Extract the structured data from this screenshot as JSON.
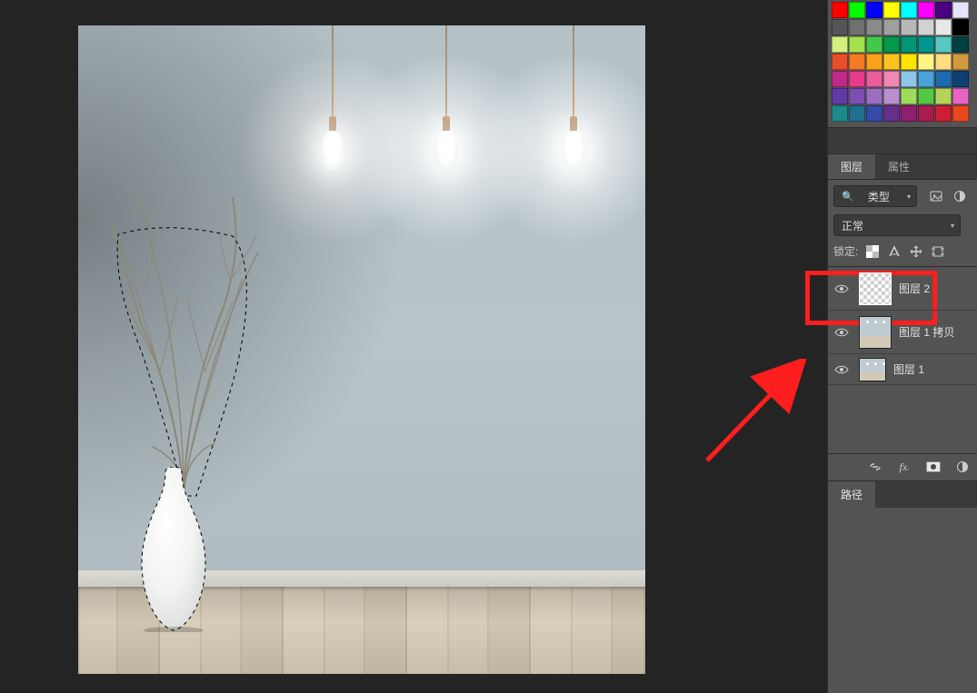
{
  "swatches": [
    "#ff0000",
    "#00ff00",
    "#0000ff",
    "#ffff00",
    "#00ffff",
    "#ff00ff",
    "#4b0082",
    "#e6e6fa",
    "#555555",
    "#707070",
    "#8a8a8a",
    "#a0a0a0",
    "#b8b8b8",
    "#d2d2d2",
    "#e8e8e8",
    "#000000",
    "#d4f07e",
    "#a3e24b",
    "#43c84a",
    "#009a4a",
    "#009778",
    "#00958d",
    "#57c9c3",
    "#004040",
    "#e94f2c",
    "#f47a25",
    "#f9a11b",
    "#fbc31e",
    "#fee400",
    "#fff685",
    "#ffdd80",
    "#d19a3f",
    "#c02a86",
    "#e83a8a",
    "#eb5d9c",
    "#f187b3",
    "#8cc7e8",
    "#48a3db",
    "#1c6bb0",
    "#103f73",
    "#5f3aa6",
    "#7b4fb1",
    "#9a6fbf",
    "#b98fce",
    "#9fdc5c",
    "#57c842",
    "#b4d55a",
    "#e864c4",
    "#1c8a8a",
    "#1f6f8f",
    "#374aa9",
    "#662f8c",
    "#901f6f",
    "#a81d4d",
    "#d01d36",
    "#e8481c"
  ],
  "tabs": {
    "layers": "图层",
    "properties": "属性"
  },
  "filter": {
    "typeLabel": "类型"
  },
  "blend": {
    "mode": "正常"
  },
  "lock": {
    "label": "锁定:"
  },
  "layers": [
    {
      "name": "图层 2"
    },
    {
      "name": "图层 1 拷贝"
    },
    {
      "name": "图层 1"
    }
  ],
  "paths_tab": "路径"
}
